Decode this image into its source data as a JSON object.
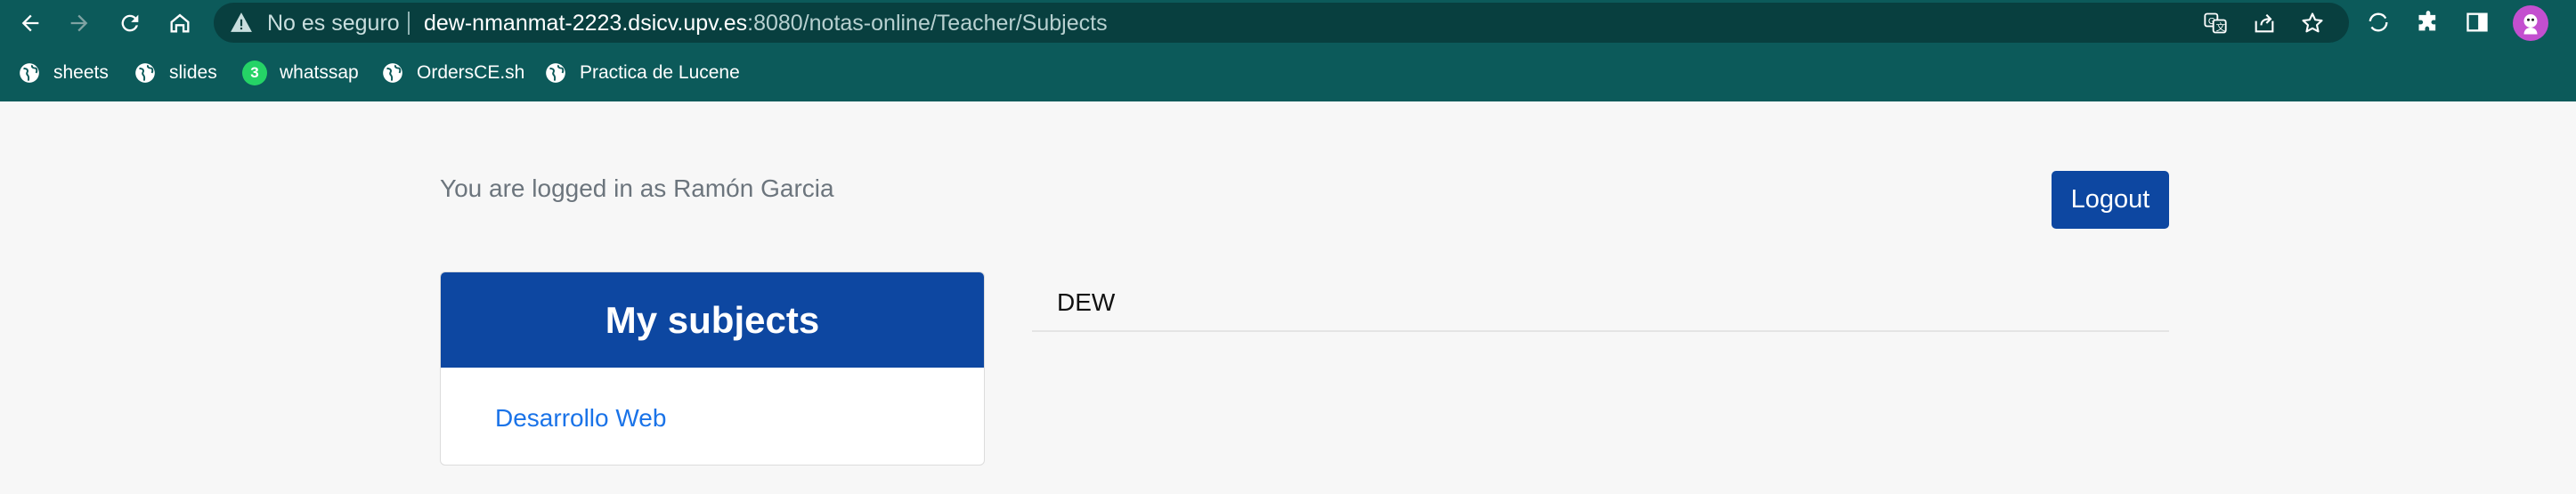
{
  "browser": {
    "security_label": "No es seguro",
    "url_host": "dew-nmanmat-2223.dsicv.upv.es",
    "url_rest": ":8080/notas-online/Teacher/Subjects",
    "colors": {
      "toolbar": "#0c5a5a",
      "omnibox": "#083f3f",
      "avatar": "#c34fcf"
    },
    "icons": [
      "back-icon",
      "forward-icon",
      "reload-icon",
      "home-icon",
      "warning-icon",
      "translate-icon",
      "share-icon",
      "star-icon",
      "sync-icon",
      "extensions-icon",
      "side-panel-icon",
      "profile-avatar"
    ]
  },
  "bookmarks": [
    {
      "label": "sheets",
      "icon": "globe-icon"
    },
    {
      "label": "slides",
      "icon": "globe-icon"
    },
    {
      "label": "whatssap",
      "icon": "whatsapp-icon",
      "badge": "3"
    },
    {
      "label": "OrdersCE.sh",
      "icon": "globe-icon"
    },
    {
      "label": "Practica de Lucene",
      "icon": "globe-icon"
    }
  ],
  "page": {
    "login_text": "You are logged in as Ramón Garcia",
    "logout_label": "Logout",
    "card_title": "My subjects",
    "subjects": [
      "Desarrollo Web"
    ],
    "active_tab": "DEW",
    "colors": {
      "primary": "#0d47a1",
      "link": "#1a73e8",
      "background": "#f7f7f7"
    }
  }
}
